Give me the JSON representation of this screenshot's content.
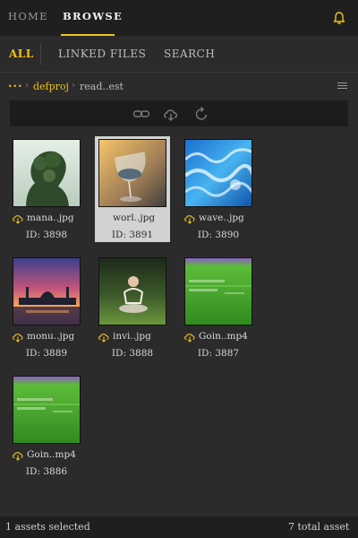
{
  "colors": {
    "accent": "#f0c419",
    "background": "#2b2b2b",
    "header": "#1f1f1f"
  },
  "top_nav": {
    "home": "HOME",
    "browse": "BROWSE",
    "notification_icon": "bell-icon"
  },
  "sub_nav": {
    "all": "ALL",
    "linked_files": "LINKED FILES",
    "search": "SEARCH"
  },
  "breadcrumb": {
    "ellipsis": "...",
    "sep1": "›",
    "folder": "defproj",
    "sep2": "›",
    "current": "read..est"
  },
  "toolbar": {
    "icons": [
      "link-icon",
      "cloud-download-icon",
      "refresh-icon"
    ]
  },
  "assets": [
    {
      "name": "mana..jpg",
      "id": "ID: 3898",
      "selected": false,
      "thumb": "double-exposure-forest-portrait"
    },
    {
      "name": "worl..jpg",
      "id": "ID: 3891",
      "selected": true,
      "thumb": "wine-glass-reflection"
    },
    {
      "name": "wave..jpg",
      "id": "ID: 3890",
      "selected": false,
      "thumb": "blue-ocean-waves"
    },
    {
      "name": "monu..jpg",
      "id": "ID: 3889",
      "selected": false,
      "thumb": "mosque-at-sunset"
    },
    {
      "name": "invi..jpg",
      "id": "ID: 3888",
      "selected": false,
      "thumb": "invisible-person-in-field"
    },
    {
      "name": "Goin..mp4",
      "id": "ID: 3887",
      "selected": false,
      "thumb": "green-grass-video"
    },
    {
      "name": "Goin..mp4",
      "id": "ID: 3886",
      "selected": false,
      "thumb": "green-grass-video"
    }
  ],
  "status": {
    "selected": "1 assets selected",
    "total": "7 total asset"
  }
}
